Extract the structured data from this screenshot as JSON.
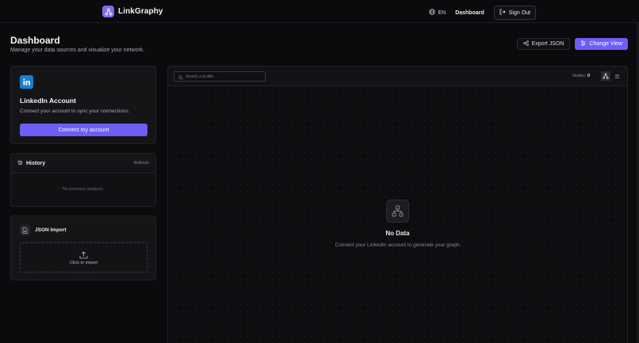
{
  "navbar": {
    "brand": "LinkGraphy",
    "language": "EN",
    "dashboard_link": "Dashboard",
    "sign_out": "Sign Out"
  },
  "header": {
    "title": "Dashboard",
    "subtitle": "Manage your data sources and visualize your network.",
    "export_button": "Export JSON",
    "change_view_button": "Change View"
  },
  "linkedin_card": {
    "title": "LinkedIn Account",
    "description": "Connect your account to sync your connections.",
    "button": "Connect my account"
  },
  "history_card": {
    "title": "History",
    "refresh": "Refresh",
    "empty": "No previous analysis."
  },
  "json_card": {
    "title": "JSON Import",
    "dropzone_label": "Click to import"
  },
  "graph": {
    "search_placeholder": "Search a profile...",
    "nodes_label": "Nodes:",
    "nodes_count": "0",
    "empty_title": "No Data",
    "empty_description": "Connect your LinkedIn account to generate your graph."
  },
  "colors": {
    "accent": "#6d5ef5",
    "linkedin": "#1a7fd4",
    "background": "#0b0b0d"
  },
  "icons": {
    "brand": "graph-nodes-icon",
    "language": "globe-icon",
    "sign_out": "logout-icon",
    "export": "share-icon",
    "change_view": "sliders-icon",
    "linkedin": "linkedin-icon",
    "history": "history-icon",
    "json": "file-icon",
    "upload": "upload-icon",
    "search": "search-icon",
    "graph_view": "graph-view-icon",
    "list_view": "list-view-icon",
    "empty_state": "network-icon"
  }
}
